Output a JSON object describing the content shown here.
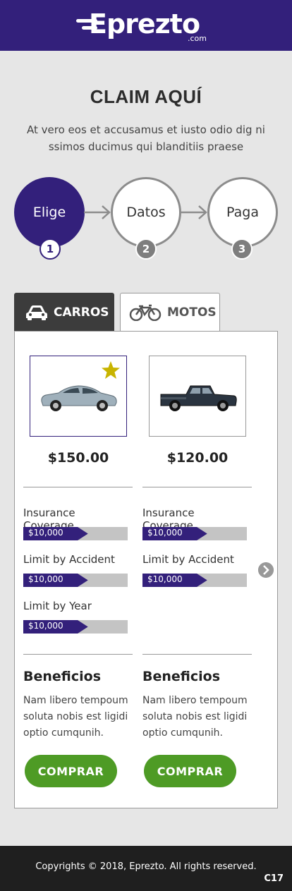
{
  "header": {
    "logo_text": "Eprezto",
    "logo_suffix": ".com"
  },
  "hero": {
    "title": "CLAIM AQUÍ",
    "subtitle": "At vero eos et accusamus et iusto odio dig ni ssimos ducimus qui blanditiis praese"
  },
  "steps": [
    {
      "label": "Elige",
      "number": "1",
      "state": "active"
    },
    {
      "label": "Datos",
      "number": "2",
      "state": "inactive"
    },
    {
      "label": "Paga",
      "number": "3",
      "state": "inactive"
    }
  ],
  "tabs": [
    {
      "label": "CARROS",
      "icon": "car-icon",
      "active": true
    },
    {
      "label": "MOTOS",
      "icon": "bicycle-icon",
      "active": false
    }
  ],
  "products": [
    {
      "price": "$150.00",
      "featured": true,
      "coverage": [
        {
          "label": "Insurance Coverage",
          "value": "$10,000"
        },
        {
          "label": "Limit by Accident",
          "value": "$10,000"
        },
        {
          "label": "Limit by Year",
          "value": "$10,000"
        }
      ],
      "benefits_title": "Beneficios",
      "benefits_text": "Nam libero tempoum soluta nobis est ligidi optio cumqunih.",
      "buy_label": "COMPRAR"
    },
    {
      "price": "$120.00",
      "featured": false,
      "coverage": [
        {
          "label": "Insurance Coverage",
          "value": "$10,000"
        },
        {
          "label": "Limit by Accident",
          "value": "$10,000"
        }
      ],
      "benefits_title": "Beneficios",
      "benefits_text": "Nam libero tempoum soluta nobis est ligidi optio cumqunih.",
      "buy_label": "COMPRAR"
    }
  ],
  "footer": {
    "copyright": "Copyrights © 2018, Eprezto. All rights reserved.",
    "tag": "C17"
  },
  "colors": {
    "brand": "#33207b",
    "buy": "#4e9b25",
    "footer": "#1f1f1f",
    "star": "#c8b400"
  }
}
